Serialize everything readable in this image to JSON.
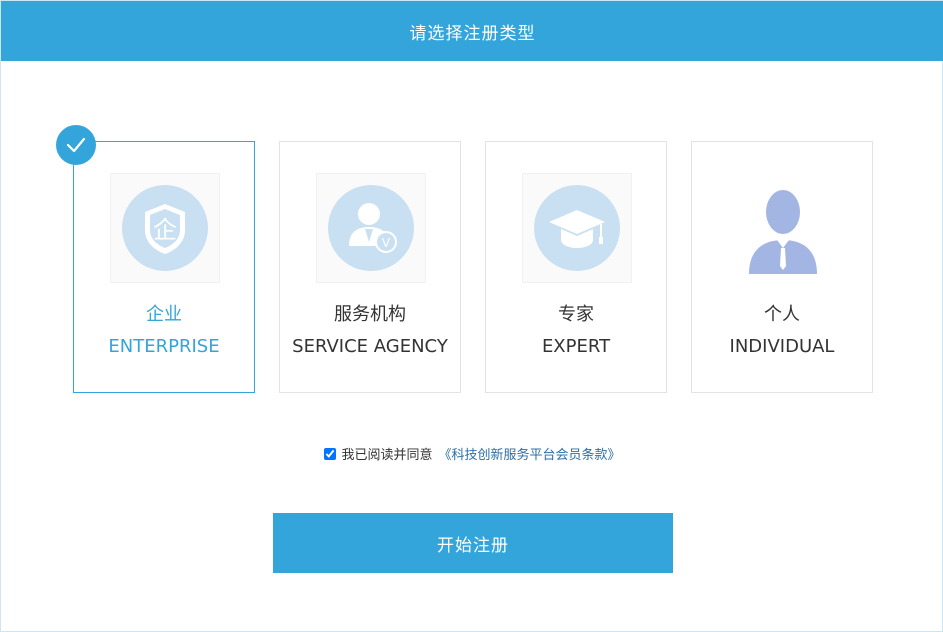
{
  "header": {
    "title": "请选择注册类型"
  },
  "cards": [
    {
      "cn": "企业",
      "en": "ENTERPRISE",
      "icon": "enterprise-shield-icon",
      "selected": true
    },
    {
      "cn": "服务机构",
      "en": "SERVICE AGENCY",
      "icon": "service-agency-icon",
      "selected": false
    },
    {
      "cn": "专家",
      "en": "EXPERT",
      "icon": "graduation-cap-icon",
      "selected": false
    },
    {
      "cn": "个人",
      "en": "INDIVIDUAL",
      "icon": "person-icon",
      "selected": false
    }
  ],
  "agreement": {
    "checked": true,
    "text": "我已阅读并同意",
    "link": "《科技创新服务平台会员条款》"
  },
  "register_button": {
    "label": "开始注册"
  },
  "colors": {
    "accent": "#34a5db",
    "icon_circle": "#c9e0f2",
    "person_icon": "#a3b5e3"
  }
}
